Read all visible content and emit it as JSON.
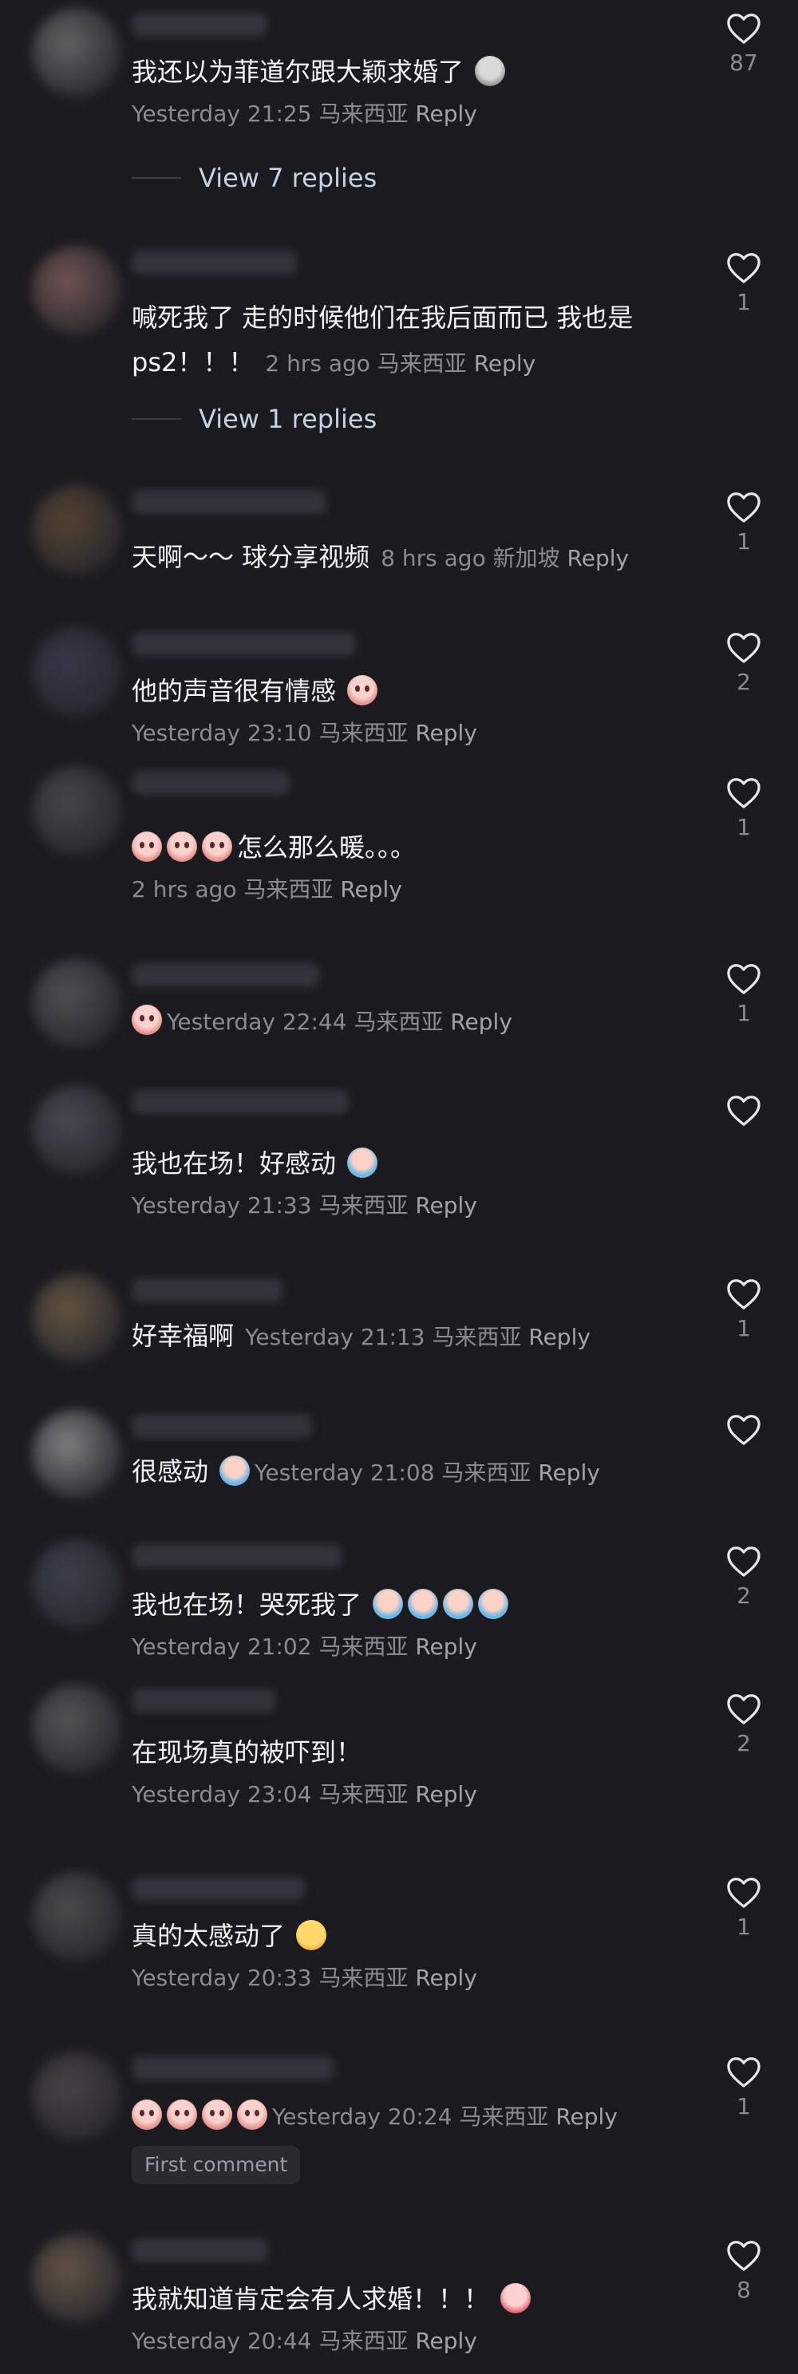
{
  "comments": [
    {
      "avatar_color": "#6a6a6a",
      "body_text": "我还以为菲道尔跟大颖求婚了",
      "emojis": [
        "gray"
      ],
      "time": "Yesterday 21:25",
      "location": "马来西亚",
      "reply": "Reply",
      "likes": "87",
      "view_replies": "View 7 replies"
    },
    {
      "avatar_color": "#7a5a56",
      "body_text": "喊死我了 走的时候他们在我后面而已 我也是ps2！！！",
      "emojis": [],
      "time": "2 hrs ago",
      "location": "马来西亚",
      "reply": "Reply",
      "likes": "1",
      "view_replies": "View 1 replies"
    },
    {
      "avatar_color": "#5a4632",
      "body_text": "天啊～～ 球分享视频",
      "emojis": [],
      "time": "8 hrs ago",
      "location": "新加坡",
      "reply": "Reply",
      "likes": "1"
    },
    {
      "avatar_color": "#3c3a4c",
      "body_text": "他的声音很有情感",
      "emojis": [
        "pink"
      ],
      "time": "Yesterday 23:10",
      "location": "马来西亚",
      "reply": "Reply",
      "likes": "2"
    },
    {
      "avatar_color": "#4a4a50",
      "body_text": "怎么那么暖。。。",
      "emojis_before": [
        "pink",
        "pink",
        "pink"
      ],
      "emojis": [],
      "time": "2 hrs ago",
      "location": "马来西亚",
      "reply": "Reply",
      "likes": "1"
    },
    {
      "avatar_color": "#555555",
      "body_text": "",
      "emojis_before": [
        "pink"
      ],
      "emojis": [],
      "time": "Yesterday 22:44",
      "location": "马来西亚",
      "reply": "Reply",
      "likes": "1"
    },
    {
      "avatar_color": "#4d4d55",
      "body_text": "我也在场！好感动",
      "emojis": [
        "blue"
      ],
      "time": "Yesterday 21:33",
      "location": "马来西亚",
      "reply": "Reply",
      "likes": ""
    },
    {
      "avatar_color": "#6a5a44",
      "body_text": "好幸福啊",
      "emojis": [],
      "time": "Yesterday 21:13",
      "location": "马来西亚",
      "reply": "Reply",
      "likes": "1"
    },
    {
      "avatar_color": "#8a8a8a",
      "body_text": "很感动",
      "emojis": [
        "blue"
      ],
      "time": "Yesterday 21:08",
      "location": "马来西亚",
      "reply": "Reply",
      "likes": ""
    },
    {
      "avatar_color": "#3f4450",
      "body_text": "我也在场！哭死我了",
      "emojis": [
        "blue",
        "blue",
        "blue",
        "blue"
      ],
      "time": "Yesterday 21:02",
      "location": "马来西亚",
      "reply": "Reply",
      "likes": "2"
    },
    {
      "avatar_color": "#5a5a5a",
      "body_text": "在现场真的被吓到！",
      "emojis": [],
      "time": "Yesterday 23:04",
      "location": "马来西亚",
      "reply": "Reply",
      "likes": "2"
    },
    {
      "avatar_color": "#505050",
      "body_text": "真的太感动了",
      "emojis": [
        "yellow"
      ],
      "time": "Yesterday 20:33",
      "location": "马来西亚",
      "reply": "Reply",
      "likes": "1"
    },
    {
      "avatar_color": "#4a4848",
      "body_text": "",
      "emojis_before": [
        "pink",
        "pink",
        "pink",
        "pink"
      ],
      "emojis": [],
      "time": "Yesterday 20:24",
      "location": "马来西亚",
      "reply": "Reply",
      "likes": "1",
      "badge": "First comment"
    },
    {
      "avatar_color": "#6a5a4a",
      "body_text": "我就知道肯定会有人求婚！！！",
      "emojis": [
        "love"
      ],
      "time": "Yesterday 20:44",
      "location": "马来西亚",
      "reply": "Reply",
      "likes": "8"
    }
  ]
}
